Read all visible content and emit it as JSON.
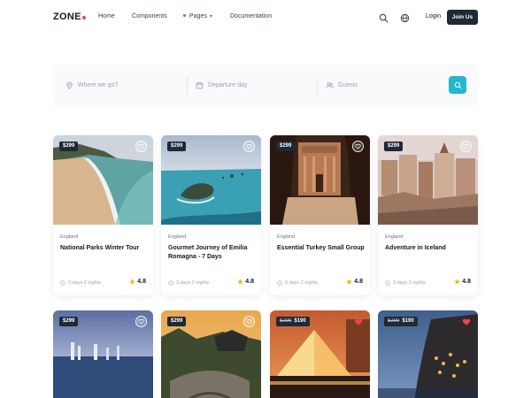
{
  "header": {
    "logo": "ZONE",
    "logo_dot_color": "#ef4444",
    "nav": [
      {
        "label": "Home"
      },
      {
        "label": "Components"
      },
      {
        "label": "Pages",
        "active_dot_color": "#ef4444"
      },
      {
        "label": "Documentation"
      }
    ],
    "icons": [
      "search-icon",
      "globe-icon"
    ],
    "login": "Login",
    "join": "Join Us"
  },
  "search": {
    "where_placeholder": "Where we go?",
    "departure_placeholder": "Departure day",
    "guests_placeholder": "Guests",
    "button_color": "#22b8cf"
  },
  "tours": [
    {
      "price": "$299",
      "location": "England",
      "title": "National Parks Winter Tour",
      "duration": "3 days 2 nights",
      "rating": "4.8"
    },
    {
      "price": "$299",
      "location": "England",
      "title": "Gourmet Journey of Emilia Romagna - 7 Days",
      "duration": "3 days 2 nights",
      "rating": "4.8"
    },
    {
      "price": "$299",
      "location": "England",
      "title": "Essential Turkey Small Group",
      "duration": "3 days 2 nights",
      "rating": "4.8"
    },
    {
      "price": "$299",
      "location": "England",
      "title": "Adventure in Iceland",
      "duration": "3 days 2 nights",
      "rating": "4.8"
    }
  ],
  "tours_row2": [
    {
      "price": "$299",
      "favorite": false
    },
    {
      "price": "$299",
      "favorite": false
    },
    {
      "old_price": "$299",
      "price": "$190",
      "favorite": true
    },
    {
      "old_price": "$299",
      "price": "$190",
      "favorite": true
    }
  ],
  "colors": {
    "star": "#f5b301",
    "heart_active": "#ef4444",
    "dark": "#1f2937"
  }
}
